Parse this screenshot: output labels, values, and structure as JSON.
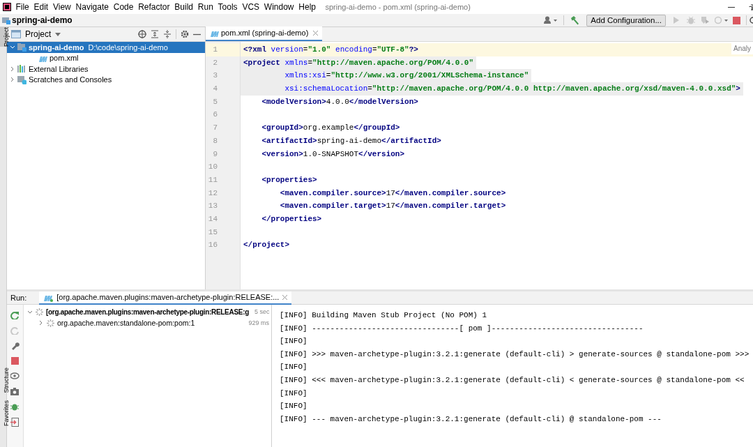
{
  "menu_bar": {
    "items": [
      "File",
      "Edit",
      "View",
      "Navigate",
      "Code",
      "Refactor",
      "Build",
      "Run",
      "Tools",
      "VCS",
      "Window",
      "Help"
    ],
    "title": "spring-ai-demo - pom.xml (spring-ai-demo)"
  },
  "nav_bar": {
    "breadcrumb": "spring-ai-demo",
    "run_config": "Add Configuration..."
  },
  "left_stripe": {
    "top_tabs": [
      {
        "label": "Project",
        "selected": true
      }
    ],
    "bottom_tabs": [
      {
        "label": "Structure",
        "selected": false
      },
      {
        "label": "Favorites",
        "selected": false
      }
    ]
  },
  "project_panel": {
    "title": "Project",
    "tree": [
      {
        "kind": "module",
        "label": "spring-ai-demo",
        "path": "D:\\code\\spring-ai-demo",
        "selected": true,
        "expanded": true,
        "children": [
          {
            "kind": "maven",
            "label": "pom.xml",
            "selected": false
          }
        ]
      },
      {
        "kind": "library",
        "label": "External Libraries",
        "selected": false,
        "expanded": false
      },
      {
        "kind": "scratches",
        "label": "Scratches and Consoles",
        "selected": false,
        "expanded": false
      }
    ]
  },
  "editor": {
    "tabs": [
      {
        "label": "pom.xml (spring-ai-demo)",
        "selected": true
      }
    ],
    "inspection": "Analy",
    "lines": [
      {
        "number": "1",
        "kind": "caret",
        "tokens": [
          {
            "kind": "tag",
            "text": "<?xml"
          },
          {
            "kind": "attr",
            "text": " version"
          },
          {
            "kind": "text",
            "text": "="
          },
          {
            "kind": "value",
            "text": "\"1.0\""
          },
          {
            "kind": "attr",
            "text": " encoding"
          },
          {
            "kind": "text",
            "text": "="
          },
          {
            "kind": "value",
            "text": "\"UTF-8\""
          },
          {
            "kind": "tag",
            "text": "?>"
          }
        ]
      },
      {
        "number": "2",
        "kind": "shaded",
        "tokens": [
          {
            "kind": "tag",
            "text": "<project"
          },
          {
            "kind": "attr",
            "text": " xmlns"
          },
          {
            "kind": "text",
            "text": "="
          },
          {
            "kind": "value",
            "text": "\"http://maven.apache.org/POM/4.0.0\""
          }
        ]
      },
      {
        "number": "3",
        "kind": "shaded",
        "tokens": [
          {
            "kind": "attr",
            "text": "         xmlns:xsi"
          },
          {
            "kind": "text",
            "text": "="
          },
          {
            "kind": "value",
            "text": "\"http://www.w3.org/2001/XMLSchema-instance\""
          }
        ]
      },
      {
        "number": "4",
        "kind": "shaded",
        "tokens": [
          {
            "kind": "attr",
            "text": "         xsi:schemaLocation"
          },
          {
            "kind": "text",
            "text": "="
          },
          {
            "kind": "value",
            "text": "\"http://maven.apache.org/POM/4.0.0 http://maven.apache.org/xsd/maven-4.0.0.xsd\""
          },
          {
            "kind": "tag",
            "text": ">"
          }
        ]
      },
      {
        "number": "5",
        "kind": "plain",
        "tokens": [
          {
            "kind": "tag",
            "text": "    <modelVersion>"
          },
          {
            "kind": "text",
            "text": "4.0.0"
          },
          {
            "kind": "tag",
            "text": "</modelVersion>"
          }
        ]
      },
      {
        "number": "6",
        "kind": "plain"
      },
      {
        "number": "7",
        "kind": "plain",
        "tokens": [
          {
            "kind": "tag",
            "text": "    <groupId>"
          },
          {
            "kind": "text",
            "text": "org.example"
          },
          {
            "kind": "tag",
            "text": "</groupId>"
          }
        ]
      },
      {
        "number": "8",
        "kind": "plain",
        "tokens": [
          {
            "kind": "tag",
            "text": "    <artifactId>"
          },
          {
            "kind": "text",
            "text": "spring-ai-demo"
          },
          {
            "kind": "tag",
            "text": "</artifactId>"
          }
        ]
      },
      {
        "number": "9",
        "kind": "plain",
        "tokens": [
          {
            "kind": "tag",
            "text": "    <version>"
          },
          {
            "kind": "text",
            "text": "1.0-SNAPSHOT"
          },
          {
            "kind": "tag",
            "text": "</version>"
          }
        ]
      },
      {
        "number": "10",
        "kind": "plain"
      },
      {
        "number": "11",
        "kind": "plain",
        "tokens": [
          {
            "kind": "tag",
            "text": "    <properties>"
          }
        ]
      },
      {
        "number": "12",
        "kind": "plain",
        "tokens": [
          {
            "kind": "tag",
            "text": "        <maven.compiler.source>"
          },
          {
            "kind": "text",
            "text": "17"
          },
          {
            "kind": "tag",
            "text": "</maven.compiler.source>"
          }
        ]
      },
      {
        "number": "13",
        "kind": "plain",
        "tokens": [
          {
            "kind": "tag",
            "text": "        <maven.compiler.target>"
          },
          {
            "kind": "text",
            "text": "17"
          },
          {
            "kind": "tag",
            "text": "</maven.compiler.target>"
          }
        ]
      },
      {
        "number": "14",
        "kind": "plain",
        "tokens": [
          {
            "kind": "tag",
            "text": "    </properties>"
          }
        ]
      },
      {
        "number": "15",
        "kind": "plain"
      },
      {
        "number": "16",
        "kind": "plain",
        "tokens": [
          {
            "kind": "tag",
            "text": "</project>"
          }
        ]
      }
    ]
  },
  "run_panel": {
    "label": "Run:",
    "tabs": [
      {
        "label": "[org.apache.maven.plugins:maven-archetype-plugin:RELEASE:...",
        "selected": true
      }
    ],
    "tree": [
      {
        "label": "[org.apache.maven.plugins:maven-archetype-plugin:RELEASE:g",
        "time": "5 sec",
        "expanded": true,
        "children": [
          {
            "label": "org.apache.maven:standalone-pom:pom:1",
            "time": "929 ms",
            "expanded": false
          }
        ]
      }
    ],
    "console": [
      "[INFO] Building Maven Stub Project (No POM) 1",
      "[INFO] --------------------------------[ pom ]---------------------------------",
      "[INFO]",
      "[INFO] >>> maven-archetype-plugin:3.2.1:generate (default-cli) > generate-sources @ standalone-pom >>>",
      "[INFO]",
      "[INFO] <<< maven-archetype-plugin:3.2.1:generate (default-cli) < generate-sources @ standalone-pom <<",
      "[INFO]",
      "[INFO]",
      "[INFO] --- maven-archetype-plugin:3.2.1:generate (default-cli) @ standalone-pom ---"
    ]
  }
}
